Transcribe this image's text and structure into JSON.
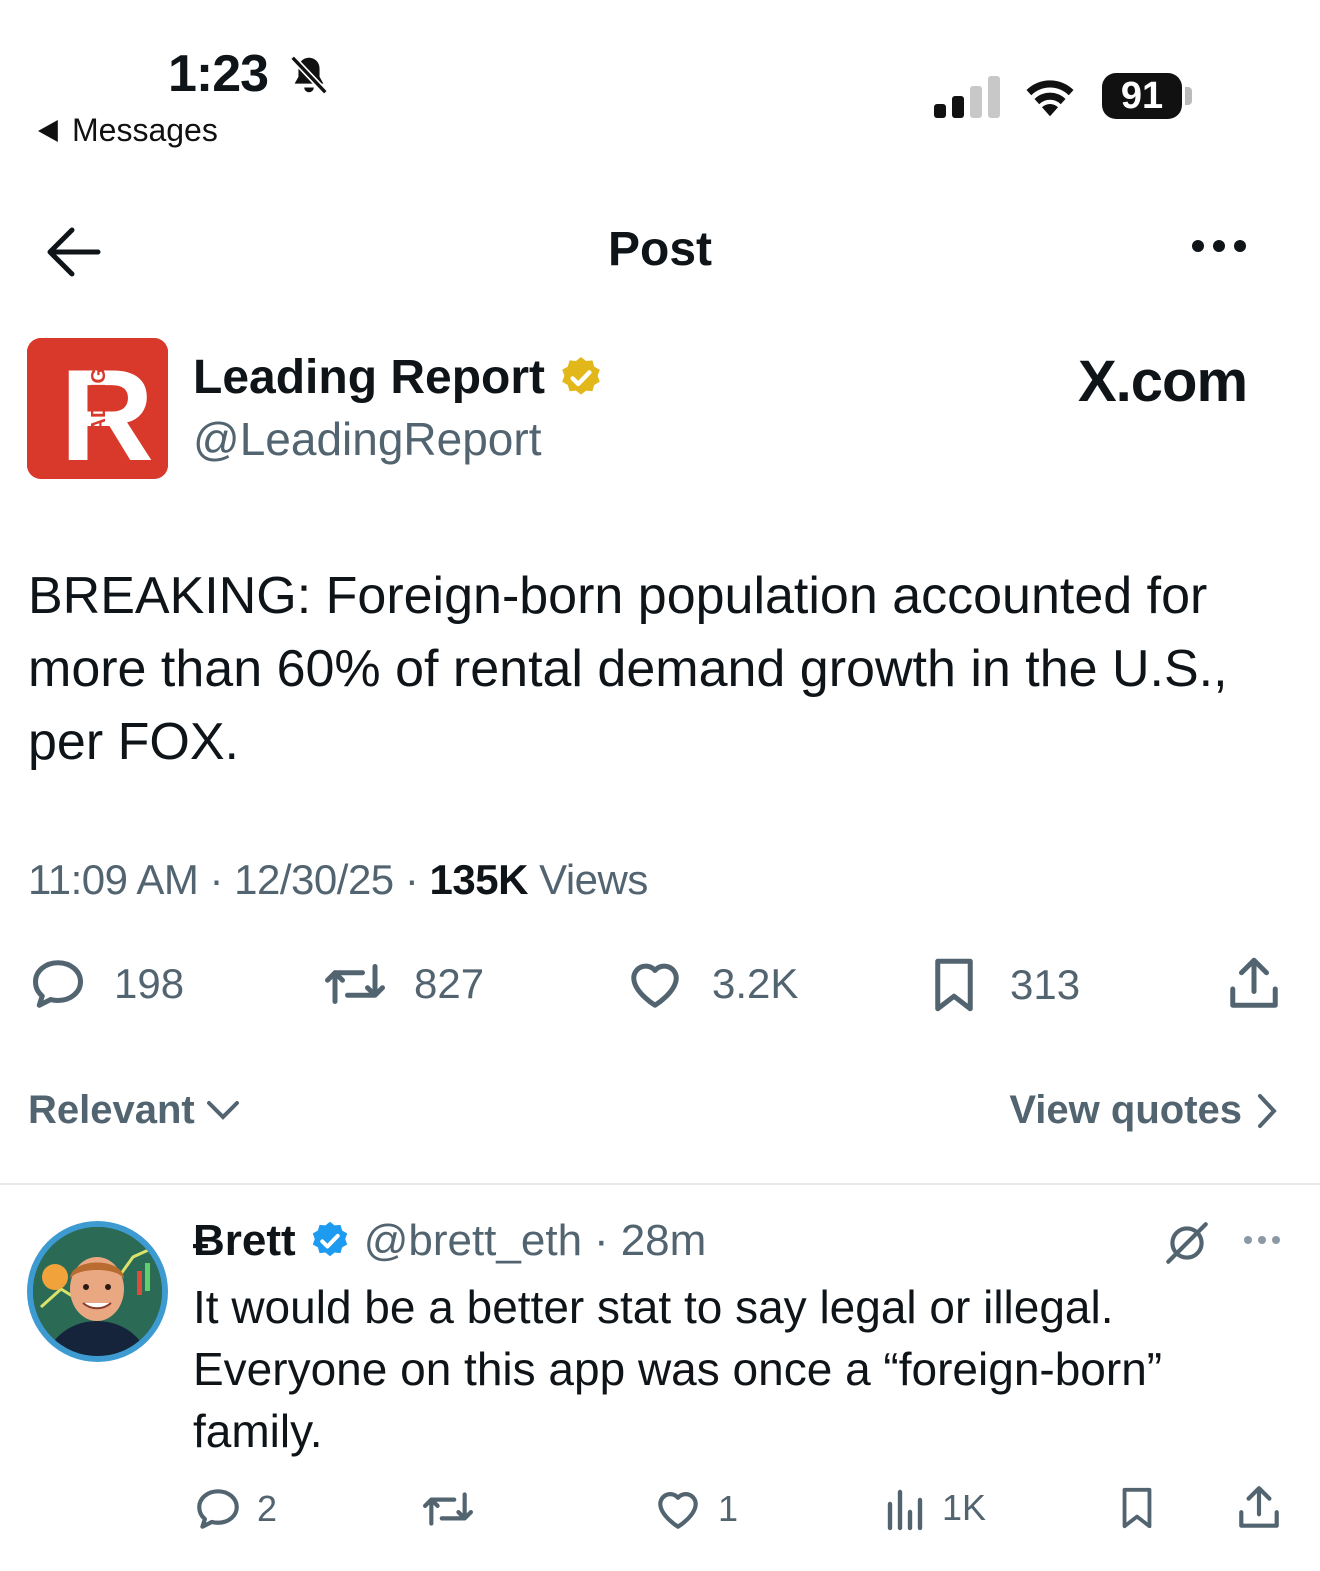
{
  "status_bar": {
    "time": "1:23",
    "back_app": "Messages",
    "battery": "91"
  },
  "header": {
    "title": "Post"
  },
  "post": {
    "author_name": "Leading Report",
    "author_handle": "@LeadingReport",
    "avatar_letter": "R",
    "avatar_side_text": "LEADING",
    "source_label": "X.com",
    "text": "BREAKING: Foreign-born population accounted for more than 60% of rental demand growth in the U.S., per FOX.",
    "time": "11:09 AM",
    "date": "12/30/25",
    "views_count": "135K",
    "views_label": "Views",
    "replies": "198",
    "reposts": "827",
    "likes": "3.2K",
    "bookmarks": "313"
  },
  "sort": {
    "label": "Relevant",
    "view_quotes": "View quotes"
  },
  "reply": {
    "name": "Ƀrett",
    "handle": "@brett_eth",
    "age": "28m",
    "text": "It would be a better stat to say legal or illegal. Everyone on this app was once a “foreign-born” family.",
    "replies": "2",
    "likes": "1",
    "views": "1K"
  },
  "colors": {
    "secondary_text": "#536471",
    "verified_blue": "#1d9bf0",
    "verified_gold": "#e2b719",
    "brand_red": "#d8392b"
  }
}
